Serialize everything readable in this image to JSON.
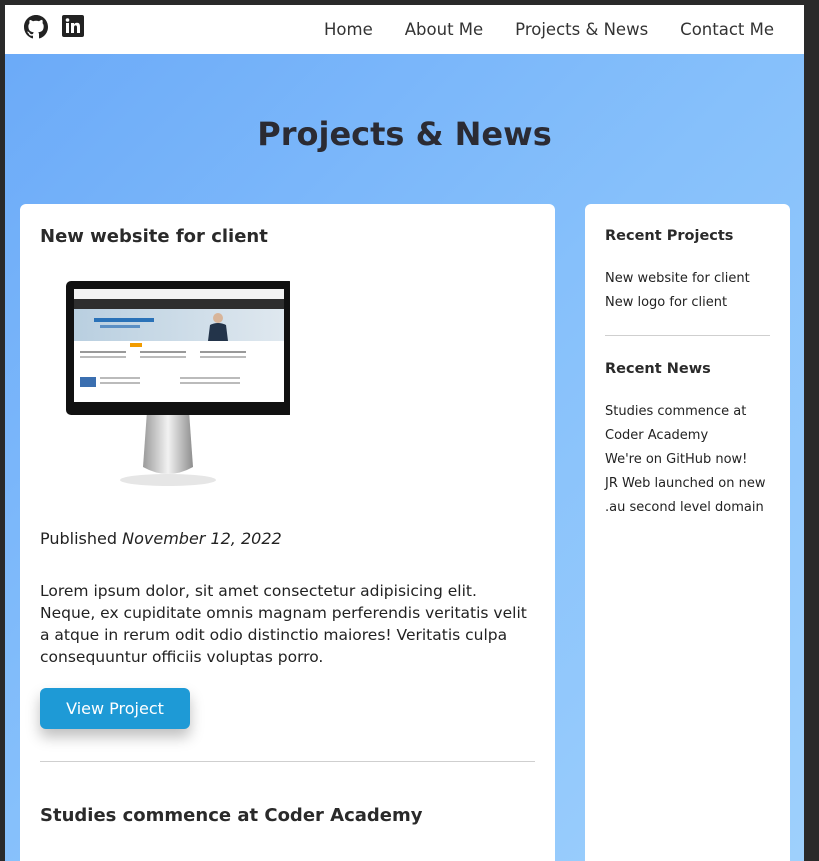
{
  "header": {
    "social": [
      {
        "icon": "github-icon"
      },
      {
        "icon": "linkedin-icon"
      }
    ],
    "nav": [
      "Home",
      "About Me",
      "Projects & News",
      "Contact Me"
    ]
  },
  "hero": {
    "title": "Projects & News"
  },
  "main": {
    "post_title": "New website for client",
    "published_label": "Published",
    "published_date": "November 12, 2022",
    "body": "Lorem ipsum dolor, sit amet consectetur adipisicing elit. Neque, ex cupiditate omnis magnam perferendis veritatis velit a atque in rerum odit odio distinctio maiores! Veritatis culpa consequuntur officiis voluptas porro.",
    "button_label": "View Project",
    "next_title": "Studies commence at Coder Academy"
  },
  "sidebar": {
    "projects_heading": "Recent Projects",
    "projects": [
      "New website for client",
      "New logo for client"
    ],
    "news_heading": "Recent News",
    "news": [
      "Studies commence at Coder Academy",
      "We're on GitHub now!",
      "JR Web launched on new .au second level domain"
    ]
  },
  "colors": {
    "accent": "#1e9ad6",
    "hero_gradient_start": "#6aa9f8",
    "hero_gradient_end": "#9ed0fc"
  }
}
